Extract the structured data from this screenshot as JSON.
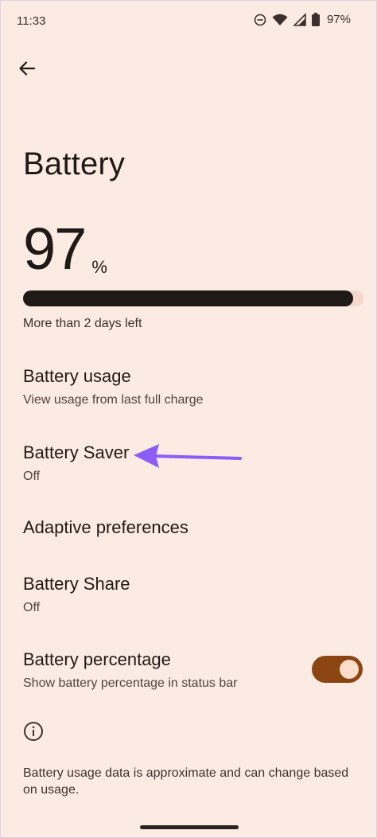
{
  "status_bar": {
    "time": "11:33",
    "battery_percent": "97%",
    "icons": [
      "do-not-disturb-icon",
      "wifi-icon",
      "cell-signal-icon",
      "battery-icon"
    ]
  },
  "header": {
    "back_icon": "arrow-left-icon",
    "title": "Battery"
  },
  "battery": {
    "level_value": "97",
    "level_unit": "%",
    "level_fraction": 0.97,
    "time_left": "More than 2 days left"
  },
  "settings": {
    "battery_usage": {
      "title": "Battery usage",
      "summary": "View usage from last full charge"
    },
    "battery_saver": {
      "title": "Battery Saver",
      "summary": "Off"
    },
    "adaptive_preferences": {
      "title": "Adaptive preferences"
    },
    "battery_share": {
      "title": "Battery Share",
      "summary": "Off"
    },
    "battery_percentage": {
      "title": "Battery percentage",
      "summary": "Show battery percentage in status bar",
      "enabled": true
    }
  },
  "footer": {
    "info_icon": "info-icon",
    "note": "Battery usage data is approximate and can change based on usage."
  },
  "colors": {
    "background": "#fcebe2",
    "toggle_on": "#8a4512",
    "annotation_arrow": "#8b5cf6"
  }
}
